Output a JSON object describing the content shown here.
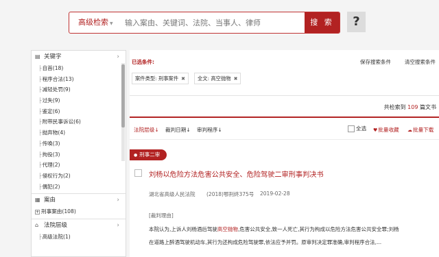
{
  "search": {
    "advanced_label": "高级检索",
    "placeholder": "输入案由、关键词、法院、当事人、律师",
    "button_label": "搜 索",
    "help_label": "?"
  },
  "sidebar": {
    "keyword_section": {
      "title": "关键字",
      "items": [
        "自首(18)",
        "程序合法(13)",
        "减轻处罚(9)",
        "过失(9)",
        "鉴定(6)",
        "附带民事诉讼(6)",
        "抛弃物(4)",
        "传唤(3)",
        "拘役(3)",
        "代理(2)",
        "侵权行为(2)",
        "偶犯(2)"
      ]
    },
    "cause_section": {
      "title": "案由",
      "items": [
        "刑事案由(108)"
      ]
    },
    "court_level_section": {
      "title": "法院层级",
      "items": [
        "高级法院(1)"
      ]
    }
  },
  "main": {
    "conditions_label": "已选条件:",
    "save_conditions": "保存搜索条件",
    "clear_conditions": "清空搜索条件",
    "tags": [
      "案件类型: 刑事案件",
      "全文: 高空抛物"
    ],
    "count_prefix": "共检索到",
    "count_value": "109",
    "count_suffix": "篇文书",
    "sort": [
      "法院层级↓",
      "裁判日期↓",
      "审判程序↓"
    ],
    "select_all": "全选",
    "bulk_favorite": "批量收藏",
    "bulk_download": "批量下载",
    "result": {
      "badge": "刑事二审",
      "title": "刘杨以危险方法危害公共安全、危险驾驶二审刑事判决书",
      "court": "湖北省高级人民法院",
      "case_no": "(2018)鄂刑终375号",
      "date": "2019-02-28",
      "reason_heading": "[裁判理由]",
      "snippet_line1_a": "本院认为,上诉人刘杨酒后驾驶",
      "snippet_line1_hl": "高空抛物",
      "snippet_line1_b": ",危害公共安全,致一人死亡,其行为构成以危险方法危害公共安全罪;刘杨",
      "snippet_line2": "在道路上醉酒驾驶机动车,其行为还构成危险驾驶罪,依法应予并罚。原审判决定罪准确,审判程序合法,..."
    }
  },
  "colors": {
    "accent": "#b22222"
  }
}
